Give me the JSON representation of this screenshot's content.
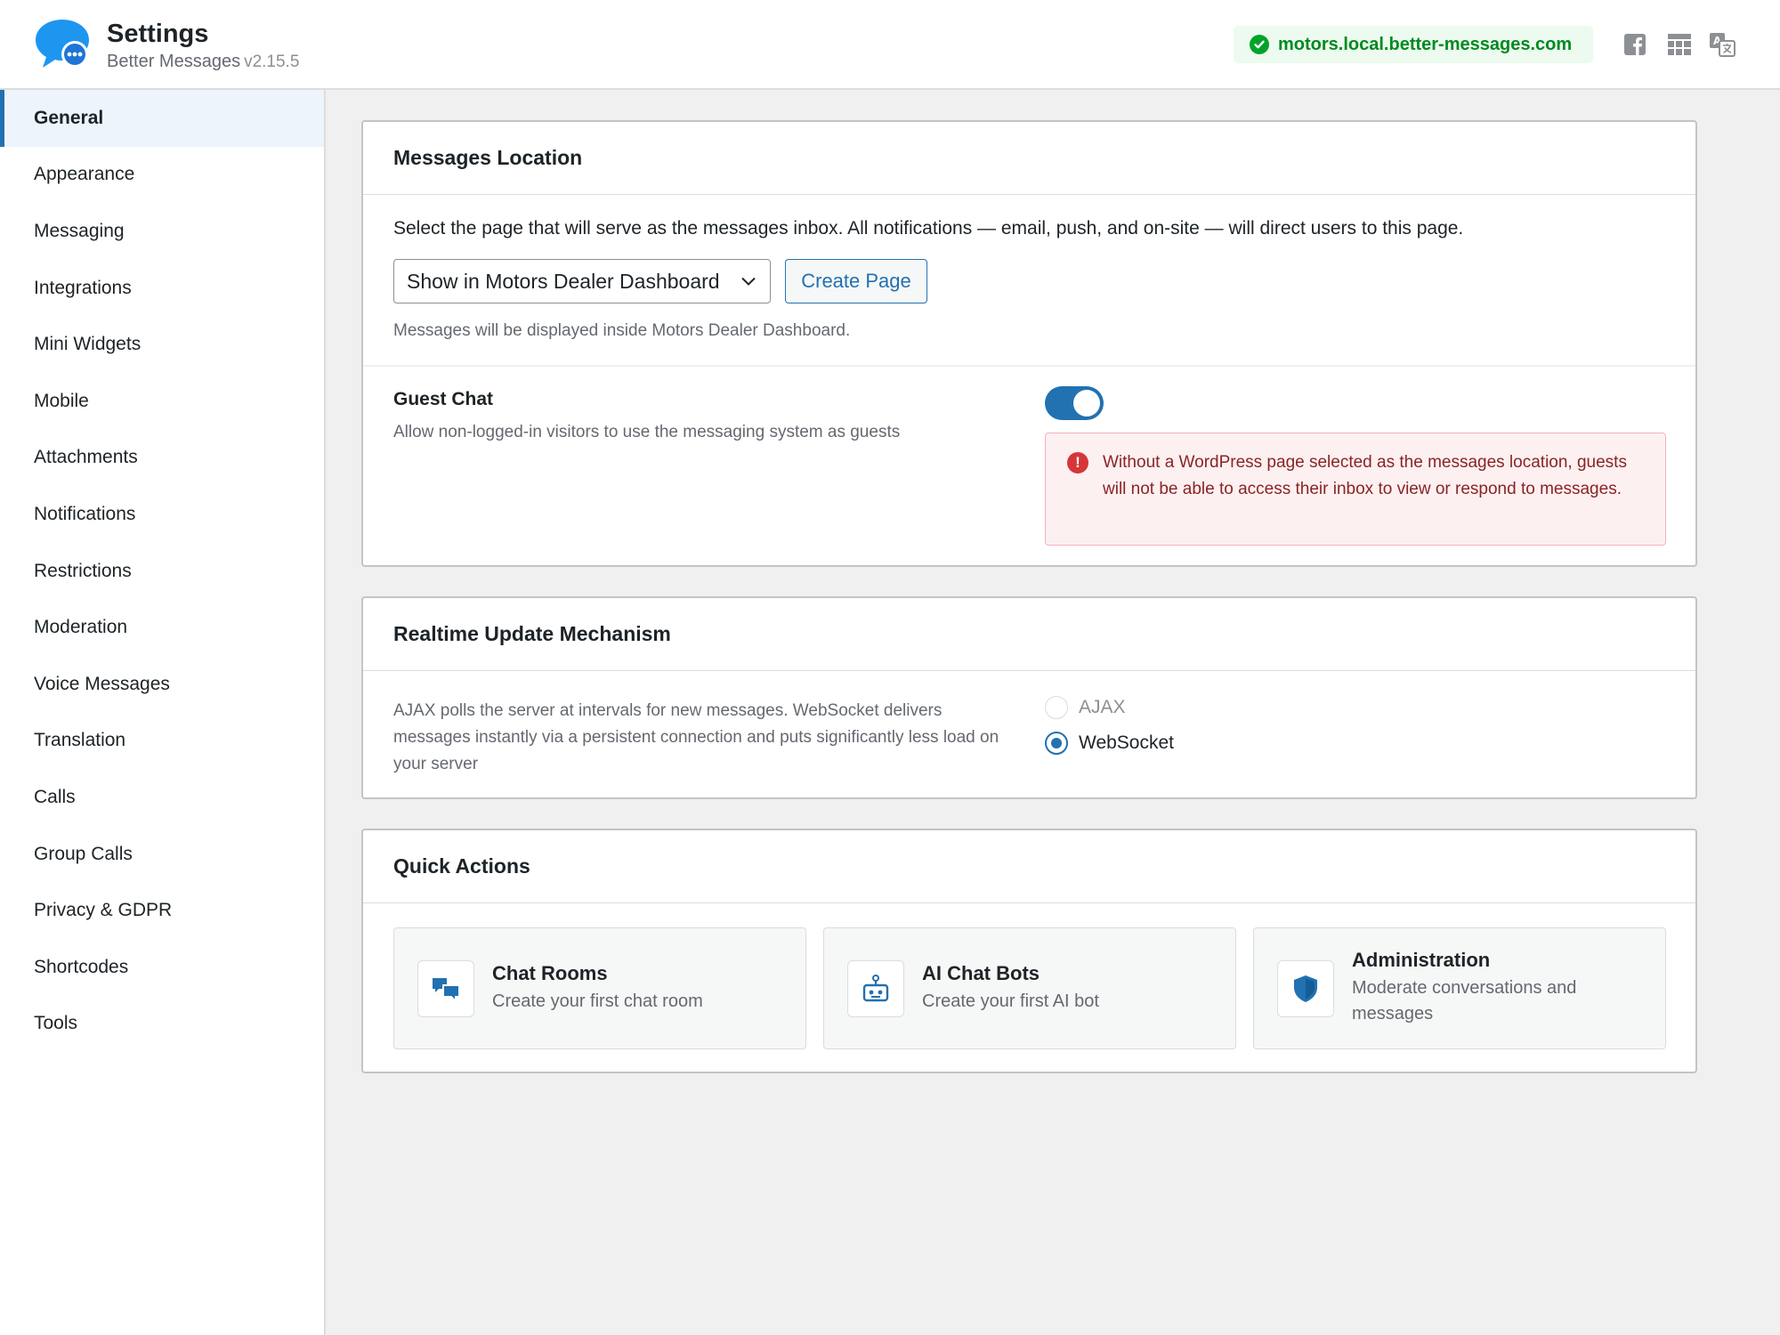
{
  "header": {
    "title": "Settings",
    "subtitle": "Better Messages",
    "version": "v2.15.5",
    "domain": "motors.local.better-messages.com",
    "icons": [
      "facebook-icon",
      "layout-icon",
      "translate-icon"
    ]
  },
  "sidebar": {
    "items": [
      {
        "label": "General",
        "active": true
      },
      {
        "label": "Appearance"
      },
      {
        "label": "Messaging"
      },
      {
        "label": "Integrations"
      },
      {
        "label": "Mini Widgets"
      },
      {
        "label": "Mobile"
      },
      {
        "label": "Attachments"
      },
      {
        "label": "Notifications"
      },
      {
        "label": "Restrictions"
      },
      {
        "label": "Moderation"
      },
      {
        "label": "Voice Messages"
      },
      {
        "label": "Translation"
      },
      {
        "label": "Calls"
      },
      {
        "label": "Group Calls"
      },
      {
        "label": "Privacy & GDPR"
      },
      {
        "label": "Shortcodes"
      },
      {
        "label": "Tools"
      }
    ]
  },
  "messages_location": {
    "title": "Messages Location",
    "description": "Select the page that will serve as the messages inbox. All notifications — email, push, and on-site — will direct users to this page.",
    "select_value": "Show in Motors Dealer Dashboard",
    "create_button": "Create Page",
    "helper": "Messages will be displayed inside Motors Dealer Dashboard.",
    "guest_chat": {
      "label": "Guest Chat",
      "description": "Allow non-logged-in visitors to use the messaging system as guests",
      "enabled": true,
      "warning": "Without a WordPress page selected as the messages location, guests will not be able to access their inbox to view or respond to messages."
    }
  },
  "realtime": {
    "title": "Realtime Update Mechanism",
    "description": "AJAX polls the server at intervals for new messages. WebSocket delivers messages instantly via a persistent connection and puts significantly less load on your server",
    "options": [
      {
        "label": "AJAX",
        "checked": false,
        "disabled": true
      },
      {
        "label": "WebSocket",
        "checked": true
      }
    ]
  },
  "quick_actions": {
    "title": "Quick Actions",
    "tiles": [
      {
        "title": "Chat Rooms",
        "subtitle": "Create your first chat room",
        "icon": "chat-rooms-icon"
      },
      {
        "title": "AI Chat Bots",
        "subtitle": "Create your first AI bot",
        "icon": "robot-icon"
      },
      {
        "title": "Administration",
        "subtitle": "Moderate conversations and messages",
        "icon": "shield-icon"
      }
    ]
  },
  "colors": {
    "accent": "#2271b1",
    "success": "#00a32a",
    "error": "#d63638"
  }
}
